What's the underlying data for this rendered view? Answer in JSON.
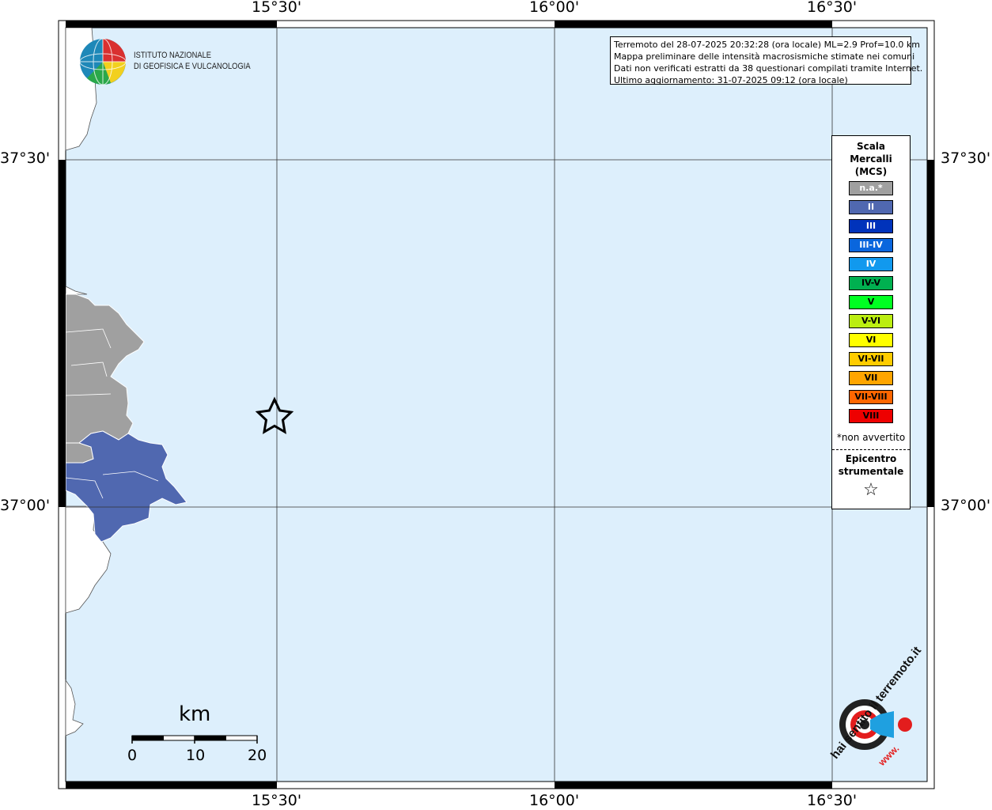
{
  "axes": {
    "lon_labels": [
      "15°30'",
      "16°00'",
      "16°30'"
    ],
    "lat_labels": [
      "37°30'",
      "37°00'"
    ]
  },
  "logo": {
    "line1": "ISTITUTO NAZIONALE",
    "line2": "DI GEOFISICA E VULCANOLOGIA"
  },
  "info": {
    "line1": "Terremoto del 28-07-2025 20:32:28 (ora locale) ML=2.9 Prof=10.0 km",
    "line2": "Mappa preliminare delle intensità macrosismiche stimate nei comuni",
    "line3": "Dati non verificati estratti da 38 questionari compilati tramite Internet.",
    "line4": "Ultimo aggiornamento: 31-07-2025 09:12 (ora locale)"
  },
  "legend": {
    "title_line1": "Scala",
    "title_line2": "Mercalli",
    "title_line3": "(MCS)",
    "items": [
      {
        "label": "n.a.*",
        "color": "#a0a0a0",
        "text_color": "#ffffff"
      },
      {
        "label": "II",
        "color": "#5068b0",
        "text_color": "#ffffff"
      },
      {
        "label": "III",
        "color": "#0033bb",
        "text_color": "#ffffff"
      },
      {
        "label": "III-IV",
        "color": "#0a66dd",
        "text_color": "#ffffff"
      },
      {
        "label": "IV",
        "color": "#1199ee",
        "text_color": "#ffffff"
      },
      {
        "label": "IV-V",
        "color": "#00b050",
        "text_color": "#000000"
      },
      {
        "label": "V",
        "color": "#00ff22",
        "text_color": "#000000"
      },
      {
        "label": "V-VI",
        "color": "#bbee11",
        "text_color": "#000000"
      },
      {
        "label": "VI",
        "color": "#ffff00",
        "text_color": "#000000"
      },
      {
        "label": "VI-VII",
        "color": "#ffcc00",
        "text_color": "#000000"
      },
      {
        "label": "VII",
        "color": "#ffa500",
        "text_color": "#000000"
      },
      {
        "label": "VII-VIII",
        "color": "#ff6600",
        "text_color": "#000000"
      },
      {
        "label": "VIII",
        "color": "#ee0000",
        "text_color": "#000000"
      }
    ],
    "note": "*non avvertito",
    "epicenter_line1": "Epicentro",
    "epicenter_line2": "strumentale",
    "epicenter_symbol": "☆"
  },
  "scale_bar": {
    "unit": "km",
    "ticks": [
      "0",
      "10",
      "20"
    ]
  },
  "branding": {
    "site_top": "hai sentito il terremoto.it",
    "site_bottom": "www."
  },
  "colors": {
    "sea": "#ddeffc",
    "land": "#ffffff",
    "not_felt": "#a0a0a0",
    "intensity_II": "#5068b0"
  }
}
